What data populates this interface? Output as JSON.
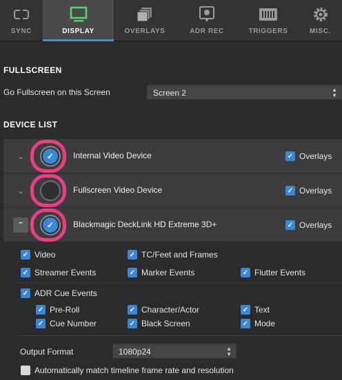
{
  "tabs": [
    {
      "label": "SYNC",
      "icon": "sync-icon"
    },
    {
      "label": "DISPLAY",
      "icon": "monitor-icon",
      "active": true
    },
    {
      "label": "OVERLAYS",
      "icon": "layers-icon"
    },
    {
      "label": "ADR REC",
      "icon": "record-icon"
    },
    {
      "label": "TRIGGERS",
      "icon": "midi-icon"
    },
    {
      "label": "MISC.",
      "icon": "gear-icon"
    }
  ],
  "fullscreen": {
    "title": "FULLSCREEN",
    "label": "Go Fullscreen on this Screen",
    "value": "Screen 2"
  },
  "device_list": {
    "title": "DEVICE LIST",
    "devices": [
      {
        "name": "Internal Video Device",
        "enabled": true,
        "overlays_label": "Overlays",
        "overlays": true,
        "expanded": false
      },
      {
        "name": "Fullscreen Video Device",
        "enabled": false,
        "overlays_label": "Overlays",
        "overlays": true,
        "expanded": false
      },
      {
        "name": "Blackmagic DeckLink HD Extreme 3D+",
        "enabled": true,
        "overlays_label": "Overlays",
        "overlays": true,
        "expanded": true
      }
    ]
  },
  "options": {
    "video": "Video",
    "tc_feet_frames": "TC/Feet and Frames",
    "streamer_events": "Streamer Events",
    "marker_events": "Marker Events",
    "flutter_events": "Flutter Events",
    "adr_cue_events": "ADR Cue Events",
    "pre_roll": "Pre-Roll",
    "character_actor": "Character/Actor",
    "text": "Text",
    "cue_number": "Cue Number",
    "black_screen": "Black Screen",
    "mode": "Mode"
  },
  "output": {
    "label": "Output Format",
    "value": "1080p24",
    "auto_match_label": "Automatically match timeline frame rate and resolution",
    "auto_match": false
  },
  "colors": {
    "accent": "#3987d9",
    "highlight": "#f03c80",
    "tab_indicator": "#3a8fe0"
  }
}
